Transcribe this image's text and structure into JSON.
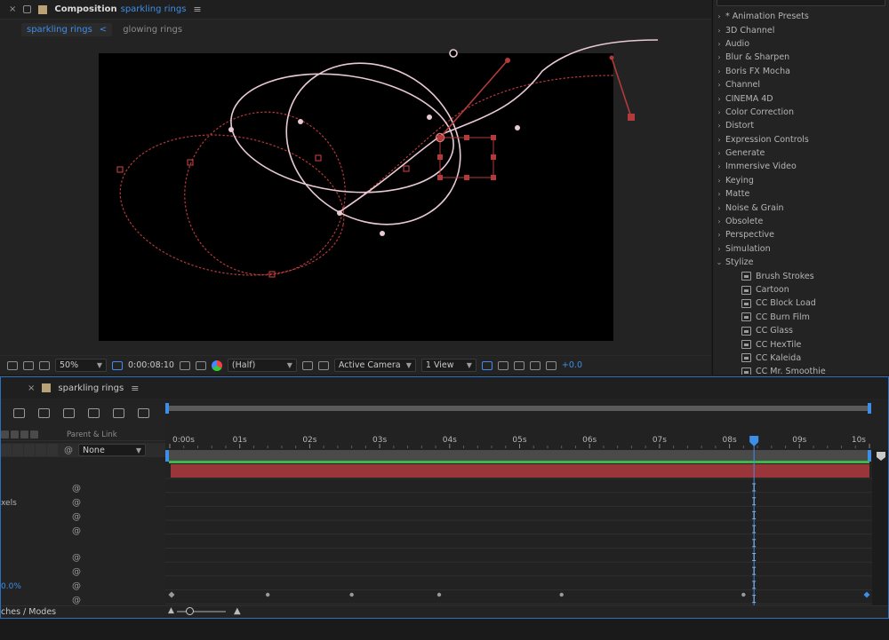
{
  "comp_panel": {
    "close": "×",
    "label": "Composition",
    "name": "sparkling rings",
    "menu": "≡",
    "tabs": [
      {
        "label": "sparkling rings",
        "arrow": "<"
      },
      {
        "label": "glowing rings"
      }
    ]
  },
  "viewer_toolbar": {
    "zoom": "50%",
    "timecode": "0:00:08:10",
    "resolution": "(Half)",
    "camera": "Active Camera",
    "views": "1 View",
    "exposure": "+0.0"
  },
  "effects": {
    "categories": [
      "* Animation Presets",
      "3D Channel",
      "Audio",
      "Blur & Sharpen",
      "Boris FX Mocha",
      "Channel",
      "CINEMA 4D",
      "Color Correction",
      "Distort",
      "Expression Controls",
      "Generate",
      "Immersive Video",
      "Keying",
      "Matte",
      "Noise & Grain",
      "Obsolete",
      "Perspective",
      "Simulation"
    ],
    "expanded": "Stylize",
    "children": [
      "Brush Strokes",
      "Cartoon",
      "CC Block Load",
      "CC Burn Film",
      "CC Glass",
      "CC HexTile",
      "CC Kaleida",
      "CC Mr. Smoothie"
    ],
    "arrow_collapsed": "›",
    "arrow_expanded": "⌄"
  },
  "timeline": {
    "close": "×",
    "tab_name": "sparkling rings",
    "menu": "≡",
    "column_header": "Parent & Link",
    "parent_value": "None",
    "prop_label_pixels": "xels",
    "prop_label_percent": "0.0%",
    "footer_label": "ches / Modes",
    "ticks": [
      "0:00s",
      "01s",
      "02s",
      "03s",
      "04s",
      "05s",
      "06s",
      "07s",
      "08s",
      "09s",
      "10s"
    ],
    "playhead_seconds": 8.35,
    "duration_seconds": 10
  },
  "colors": {
    "accent": "#3d8ee7",
    "path_pink": "#e9c9d3",
    "path_red": "#b33a3a",
    "layer_bar": "#9a3539",
    "work_area": "#3cb94a"
  }
}
